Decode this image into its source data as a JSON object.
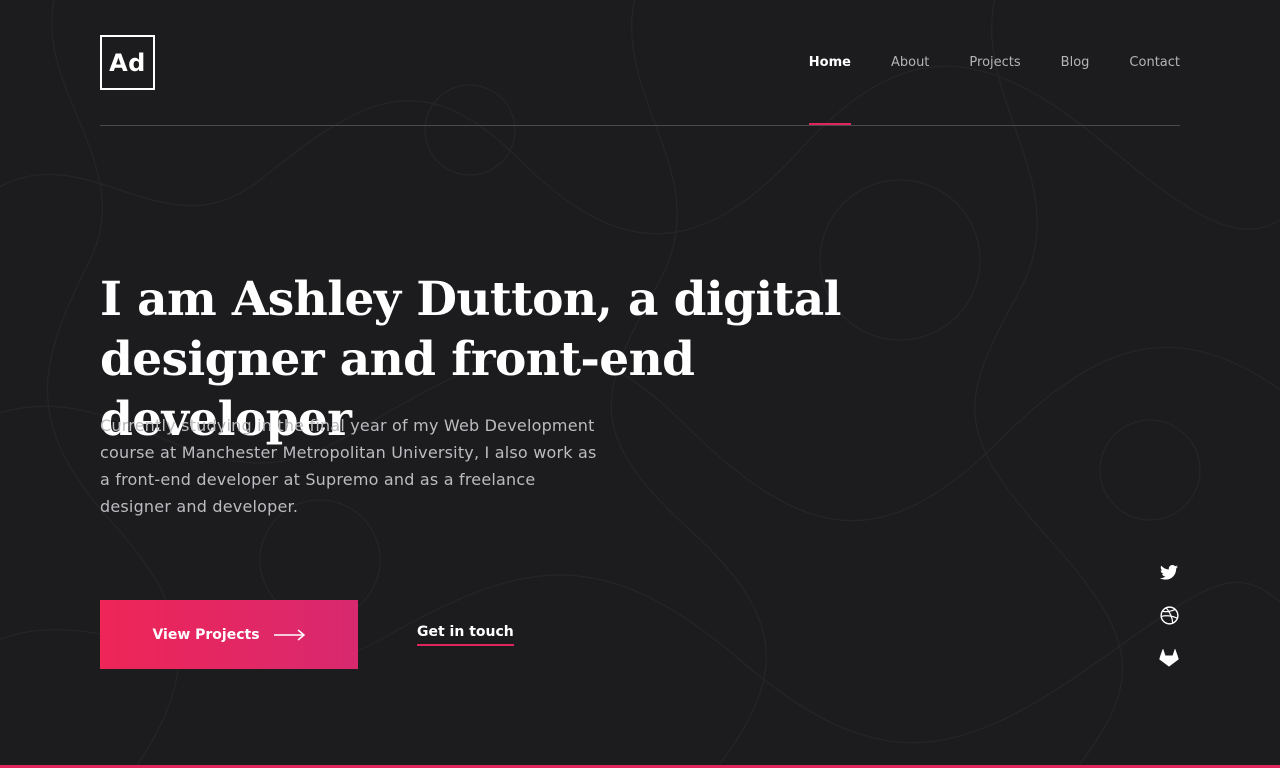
{
  "logo": {
    "text": "Ad"
  },
  "nav": {
    "items": [
      {
        "label": "Home",
        "active": true
      },
      {
        "label": "About",
        "active": false
      },
      {
        "label": "Projects",
        "active": false
      },
      {
        "label": "Blog",
        "active": false
      },
      {
        "label": "Contact",
        "active": false
      }
    ]
  },
  "hero": {
    "headline": "I am Ashley Dutton, a digital designer and front-end developer",
    "intro": "Currently studying in the final year of my Web Development course at Manchester Metropolitan University, I also work as a front-end developer at Supremo and as a freelance designer and developer.",
    "primary_button": "View Projects",
    "secondary_link": "Get in touch"
  },
  "social": {
    "icons": [
      "twitter-icon",
      "dribbble-icon",
      "gitlab-icon"
    ]
  },
  "colors": {
    "background": "#1c1c1e",
    "accent": "#e0245e",
    "gradient_start": "#ee2557",
    "gradient_end": "#d8296f",
    "muted_text": "#bcbcc0"
  }
}
